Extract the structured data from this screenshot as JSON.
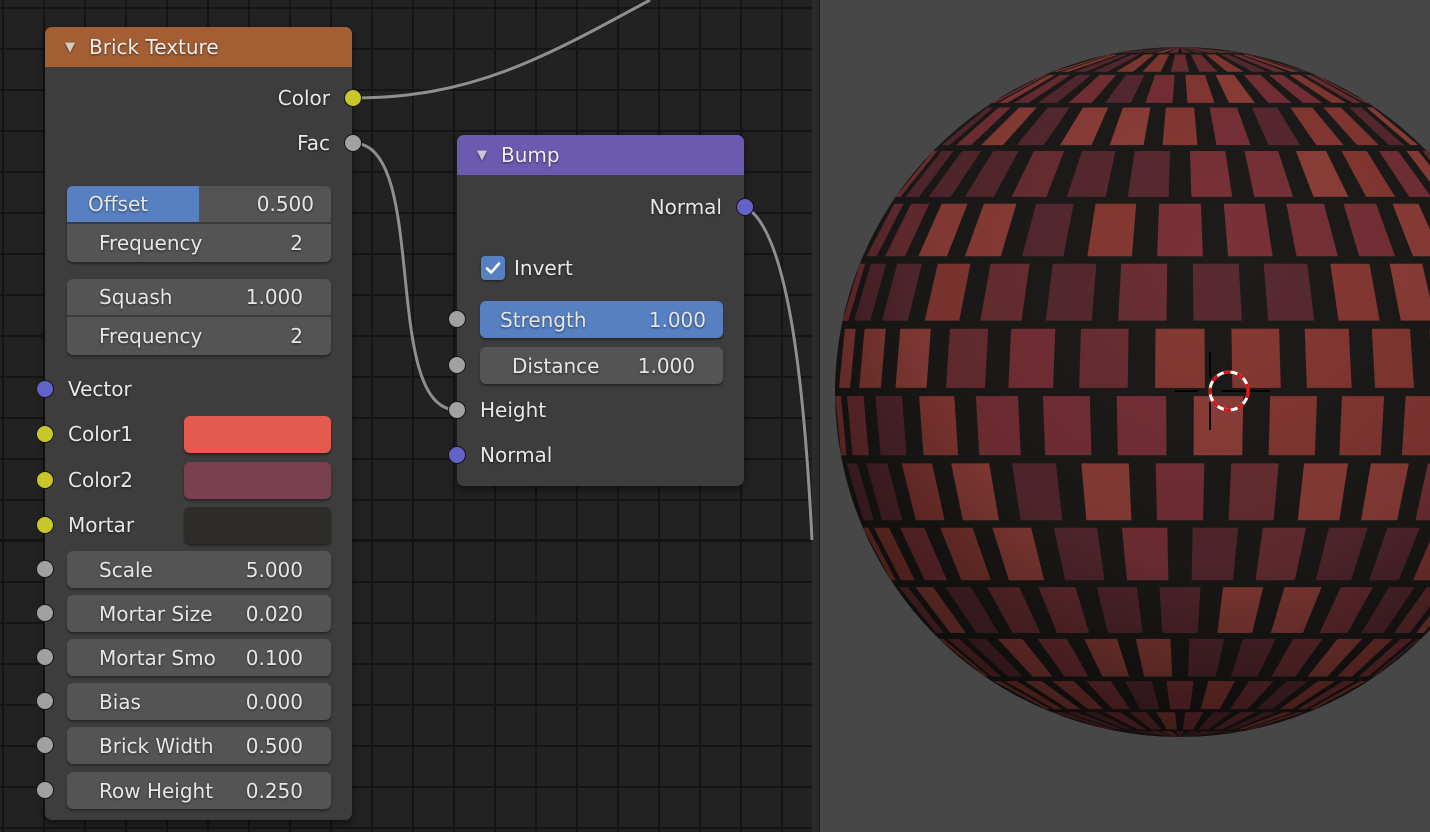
{
  "node_editor": {
    "brick_texture": {
      "title": "Brick Texture",
      "header_color": "#a35f33",
      "outputs": [
        {
          "label": "Color",
          "socket": "yellow"
        },
        {
          "label": "Fac",
          "socket": "gray"
        }
      ],
      "offset": {
        "label": "Offset",
        "value": "0.500",
        "fill_fraction": 0.5
      },
      "offset_frequency": {
        "label": "Frequency",
        "value": "2"
      },
      "squash": {
        "label": "Squash",
        "value": "1.000"
      },
      "squash_frequency": {
        "label": "Frequency",
        "value": "2"
      },
      "inputs": {
        "vector": {
          "label": "Vector",
          "socket": "blue"
        },
        "color1": {
          "label": "Color1",
          "socket": "yellow",
          "swatch": "#e55a4e"
        },
        "color2": {
          "label": "Color2",
          "socket": "yellow",
          "swatch": "#7a404f"
        },
        "mortar": {
          "label": "Mortar",
          "socket": "yellow",
          "swatch": "#2d2c28"
        }
      },
      "fields": [
        {
          "label": "Scale",
          "value": "5.000"
        },
        {
          "label": "Mortar Size",
          "value": "0.020"
        },
        {
          "label": "Mortar Smo",
          "value": "0.100"
        },
        {
          "label": "Bias",
          "value": "0.000"
        },
        {
          "label": "Brick Width",
          "value": "0.500"
        },
        {
          "label": "Row Height",
          "value": "0.250"
        }
      ]
    },
    "bump": {
      "title": "Bump",
      "header_color": "#6c5ab0",
      "output": {
        "label": "Normal",
        "socket": "blue"
      },
      "invert": {
        "label": "Invert",
        "checked": true
      },
      "strength": {
        "label": "Strength",
        "value": "1.000"
      },
      "distance": {
        "label": "Distance",
        "value": "1.000"
      },
      "inputs": [
        {
          "label": "Height",
          "socket": "gray"
        },
        {
          "label": "Normal",
          "socket": "blue"
        }
      ]
    }
  },
  "viewport": {
    "background": "#474747",
    "object": "brick-textured-sphere",
    "brick_colors": [
      "#8a3a34",
      "#7a3238",
      "#5a2a32",
      "#92403a",
      "#6e3034"
    ],
    "mortar_color": "#1e1c1a",
    "cursor": "3d-cursor"
  }
}
